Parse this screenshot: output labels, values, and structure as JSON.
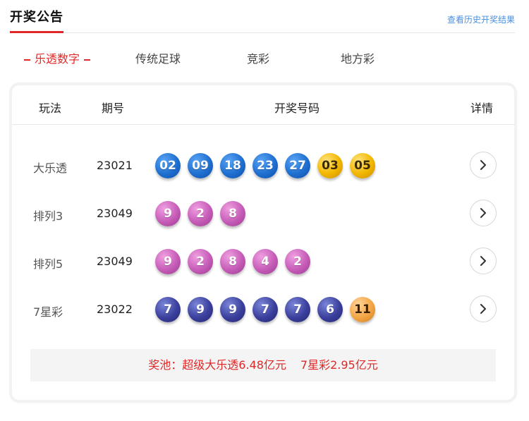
{
  "header": {
    "title": "开奖公告",
    "history_link": "查看历史开奖结果"
  },
  "tabs": [
    {
      "label": "乐透数字",
      "active": true
    },
    {
      "label": "传统足球",
      "active": false
    },
    {
      "label": "竞彩",
      "active": false
    },
    {
      "label": "地方彩",
      "active": false
    }
  ],
  "table": {
    "columns": {
      "play": "玩法",
      "issue": "期号",
      "numbers": "开奖号码",
      "detail": "详情"
    },
    "rows": [
      {
        "name": "大乐透",
        "issue": "23021",
        "balls": [
          {
            "n": "02",
            "color": "blue"
          },
          {
            "n": "09",
            "color": "blue"
          },
          {
            "n": "18",
            "color": "blue"
          },
          {
            "n": "23",
            "color": "blue"
          },
          {
            "n": "27",
            "color": "blue"
          },
          {
            "n": "03",
            "color": "gold"
          },
          {
            "n": "05",
            "color": "gold"
          }
        ]
      },
      {
        "name": "排列3",
        "issue": "23049",
        "balls": [
          {
            "n": "9",
            "color": "purple"
          },
          {
            "n": "2",
            "color": "purple"
          },
          {
            "n": "8",
            "color": "purple"
          }
        ]
      },
      {
        "name": "排列5",
        "issue": "23049",
        "balls": [
          {
            "n": "9",
            "color": "purple"
          },
          {
            "n": "2",
            "color": "purple"
          },
          {
            "n": "8",
            "color": "purple"
          },
          {
            "n": "4",
            "color": "purple"
          },
          {
            "n": "2",
            "color": "purple"
          }
        ]
      },
      {
        "name": "7星彩",
        "issue": "23022",
        "balls": [
          {
            "n": "7",
            "color": "navy"
          },
          {
            "n": "9",
            "color": "navy"
          },
          {
            "n": "9",
            "color": "navy"
          },
          {
            "n": "7",
            "color": "navy"
          },
          {
            "n": "7",
            "color": "navy"
          },
          {
            "n": "6",
            "color": "navy"
          },
          {
            "n": "11",
            "color": "orange"
          }
        ]
      }
    ]
  },
  "pool": {
    "dlt": "奖池：超级大乐透6.48亿元",
    "qxc": "7星彩2.95亿元"
  },
  "colors": {
    "accent": "#e02828",
    "link": "#4a8fe0",
    "ball_blue": "#1f6fd0",
    "ball_gold": "#f2b600",
    "ball_purple": "#c65cb8",
    "ball_navy": "#3a3f9c",
    "ball_orange": "#f3a545"
  },
  "icons": {
    "detail": "chevron-right-icon"
  }
}
